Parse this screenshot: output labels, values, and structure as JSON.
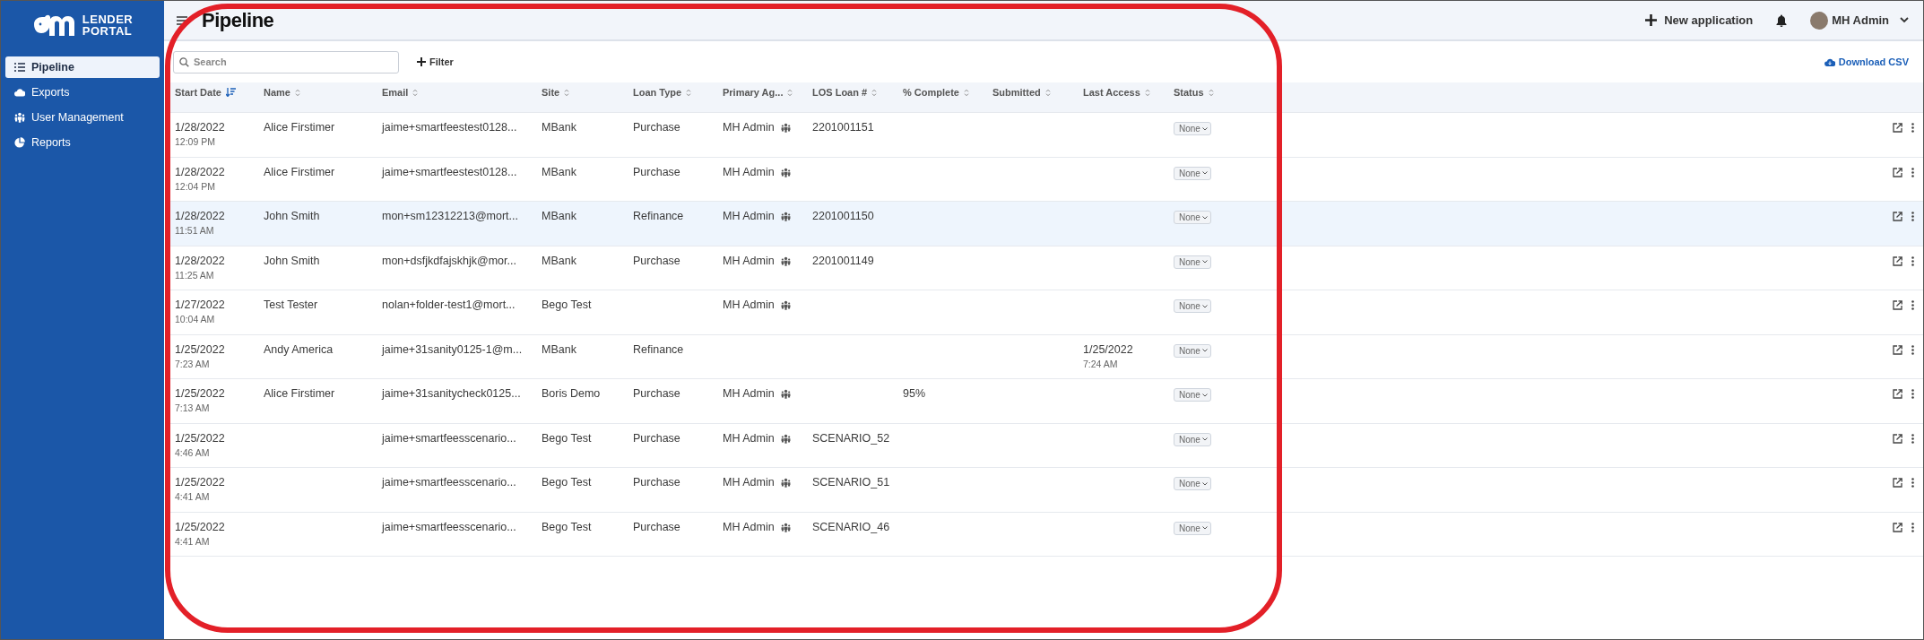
{
  "sidebar": {
    "logo": {
      "line_1": "LENDER",
      "line_2": "PORTAL"
    },
    "items": [
      {
        "label": "Pipeline",
        "selected": true
      },
      {
        "label": "Exports",
        "selected": false
      },
      {
        "label": "User Management",
        "selected": false
      },
      {
        "label": "Reports",
        "selected": false
      }
    ]
  },
  "header": {
    "title": "Pipeline",
    "new_button": "New application",
    "user": "MH Admin"
  },
  "toolbar": {
    "search": {
      "placeholder": "Search"
    },
    "filter": "Filter",
    "download": "Download CSV"
  },
  "table": {
    "columns": [
      {
        "label": "Start Date",
        "sorted": true
      },
      {
        "label": "Name",
        "sorted": false
      },
      {
        "label": "Email",
        "sorted": false
      },
      {
        "label": "Site",
        "sorted": false
      },
      {
        "label": "Loan Type",
        "sorted": false
      },
      {
        "label": "Primary Ag...",
        "sorted": false
      },
      {
        "label": "LOS Loan #",
        "sorted": false
      },
      {
        "label": "% Complete",
        "sorted": false
      },
      {
        "label": "Submitted",
        "sorted": false
      },
      {
        "label": "Last Access",
        "sorted": false
      },
      {
        "label": "Status",
        "sorted": false
      }
    ],
    "rows": [
      {
        "date": "1/28/2022",
        "time": "12:09 PM",
        "name": "Alice Firstimer",
        "email": "jaime+smartfeestest0128...",
        "site": "MBank",
        "loan_type": "Purchase",
        "agent": "MH Admin",
        "los_loan": "2201001151",
        "status": "None",
        "selected": false
      },
      {
        "date": "1/28/2022",
        "time": "12:04 PM",
        "name": "Alice Firstimer",
        "email": "jaime+smartfeestest0128...",
        "site": "MBank",
        "loan_type": "Purchase",
        "agent": "MH Admin",
        "status": "None",
        "selected": false
      },
      {
        "date": "1/28/2022",
        "time": "11:51 AM",
        "name": "John Smith",
        "email": "mon+sm12312213@mort...",
        "site": "MBank",
        "loan_type": "Refinance",
        "agent": "MH Admin",
        "los_loan": "2201001150",
        "status": "None",
        "selected": true
      },
      {
        "date": "1/28/2022",
        "time": "11:25 AM",
        "name": "John Smith",
        "email": "mon+dsfjkdfajskhjk@mor...",
        "site": "MBank",
        "loan_type": "Purchase",
        "agent": "MH Admin",
        "los_loan": "2201001149",
        "status": "None",
        "selected": false
      },
      {
        "date": "1/27/2022",
        "time": "10:04 AM",
        "name": "Test Tester",
        "email": "nolan+folder-test1@mort...",
        "site": "Bego Test",
        "agent": "MH Admin",
        "status": "None",
        "selected": false
      },
      {
        "date": "1/25/2022",
        "time": "7:23 AM",
        "name": "Andy America",
        "email": "jaime+31sanity0125-1@m...",
        "site": "MBank",
        "loan_type": "Refinance",
        "last_access_date": "1/25/2022",
        "last_access_time": "7:24 AM",
        "status": "None",
        "selected": false
      },
      {
        "date": "1/25/2022",
        "time": "7:13 AM",
        "name": "Alice Firstimer",
        "email": "jaime+31sanitycheck0125...",
        "site": "Boris Demo",
        "loan_type": "Purchase",
        "agent": "MH Admin",
        "complete": "95%",
        "status": "None",
        "selected": false
      },
      {
        "date": "1/25/2022",
        "time": "4:46 AM",
        "email": "jaime+smartfeesscenario...",
        "site": "Bego Test",
        "loan_type": "Purchase",
        "agent": "MH Admin",
        "los_loan": "SCENARIO_52",
        "status": "None",
        "selected": false
      },
      {
        "date": "1/25/2022",
        "time": "4:41 AM",
        "email": "jaime+smartfeesscenario...",
        "site": "Bego Test",
        "loan_type": "Purchase",
        "agent": "MH Admin",
        "los_loan": "SCENARIO_51",
        "status": "None",
        "selected": false
      },
      {
        "date": "1/25/2022",
        "time": "4:41 AM",
        "email": "jaime+smartfeesscenario...",
        "site": "Bego Test",
        "loan_type": "Purchase",
        "agent": "MH Admin",
        "los_loan": "SCENARIO_46",
        "status": "None",
        "selected": false
      }
    ]
  }
}
